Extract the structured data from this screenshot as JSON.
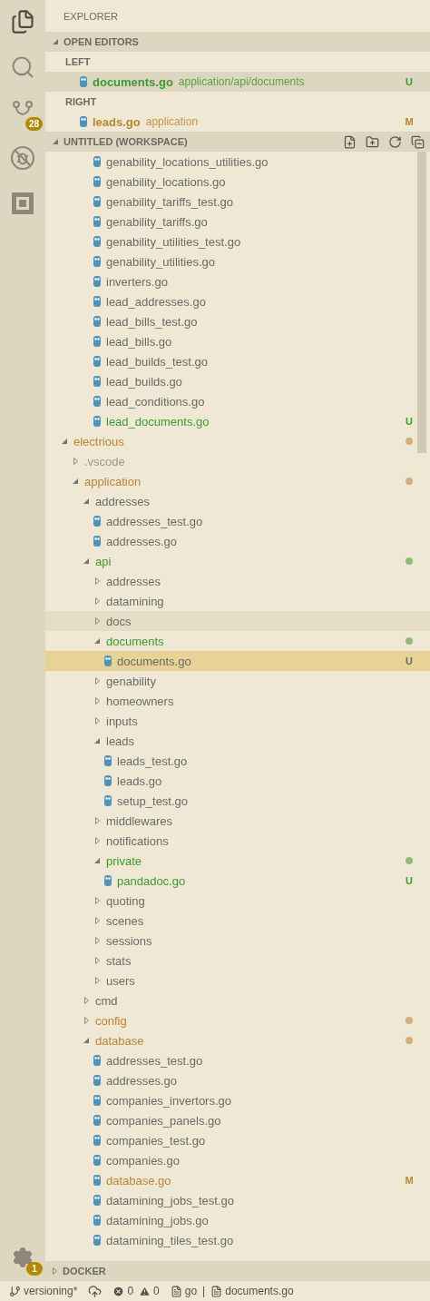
{
  "activity_bar": {
    "source_control_badge": "28",
    "settings_badge": "1"
  },
  "explorer": {
    "title": "EXPLORER",
    "open_editors": {
      "title": "OPEN EDITORS",
      "expanded": true,
      "groups": [
        {
          "label": "LEFT",
          "files": [
            {
              "name": "documents.go",
              "path": "application/api/documents",
              "badge": "U",
              "color": "#3d9a2e",
              "selected": true
            }
          ]
        },
        {
          "label": "RIGHT",
          "files": [
            {
              "name": "leads.go",
              "path": "application",
              "badge": "M",
              "color": "#b8862f",
              "selected": false
            }
          ]
        }
      ]
    },
    "workspace": {
      "title": "UNTITLED (WORKSPACE)",
      "expanded": true,
      "partial_files": [
        {
          "name": "genability_locations_utilities.go",
          "kind": "file",
          "selected": false,
          "hovered": false
        },
        {
          "name": "genability_locations.go",
          "kind": "file",
          "selected": false,
          "hovered": false
        },
        {
          "name": "genability_tariffs_test.go",
          "kind": "file",
          "selected": false,
          "hovered": false
        },
        {
          "name": "genability_tariffs.go",
          "kind": "file",
          "selected": false,
          "hovered": false
        },
        {
          "name": "genability_utilities_test.go",
          "kind": "file",
          "selected": false,
          "hovered": false
        },
        {
          "name": "genability_utilities.go",
          "kind": "file",
          "selected": false,
          "hovered": false
        },
        {
          "name": "inverters.go",
          "kind": "file",
          "selected": false,
          "hovered": false
        },
        {
          "name": "lead_addresses.go",
          "kind": "file",
          "selected": false,
          "hovered": false
        },
        {
          "name": "lead_bills_test.go",
          "kind": "file",
          "selected": false,
          "hovered": false
        },
        {
          "name": "lead_bills.go",
          "kind": "file",
          "selected": false,
          "hovered": false
        },
        {
          "name": "lead_builds_test.go",
          "kind": "file",
          "selected": false,
          "hovered": false
        },
        {
          "name": "lead_builds.go",
          "kind": "file",
          "selected": false,
          "hovered": false
        },
        {
          "name": "lead_conditions.go",
          "kind": "file",
          "selected": false,
          "hovered": false
        },
        {
          "name": "lead_documents.go",
          "kind": "file",
          "color": "#3d9a2e",
          "badge": "U",
          "selected": false,
          "hovered": false
        }
      ],
      "tree": [
        {
          "name": "electrious",
          "kind": "folder",
          "expanded": true,
          "color": "#b8862f",
          "dot": true,
          "selected": false,
          "hovered": false,
          "children": [
            {
              "name": ".vscode",
              "kind": "folder",
              "expanded": false,
              "color": "#9c9a90",
              "dot": false,
              "selected": false,
              "hovered": false
            },
            {
              "name": "application",
              "kind": "folder",
              "expanded": true,
              "color": "#b8862f",
              "dot": true,
              "selected": false,
              "hovered": false,
              "children": [
                {
                  "name": "addresses",
                  "kind": "folder",
                  "expanded": true,
                  "selected": false,
                  "hovered": false,
                  "children": [
                    {
                      "name": "addresses_test.go",
                      "kind": "file",
                      "selected": false,
                      "hovered": false
                    },
                    {
                      "name": "addresses.go",
                      "kind": "file",
                      "selected": false,
                      "hovered": false
                    }
                  ]
                },
                {
                  "name": "api",
                  "kind": "folder",
                  "expanded": true,
                  "color": "#3d9a2e",
                  "dot": true,
                  "selected": false,
                  "hovered": false,
                  "children": [
                    {
                      "name": "addresses",
                      "kind": "folder",
                      "expanded": false,
                      "selected": false,
                      "hovered": false
                    },
                    {
                      "name": "datamining",
                      "kind": "folder",
                      "expanded": false,
                      "selected": false,
                      "hovered": false
                    },
                    {
                      "name": "docs",
                      "kind": "folder",
                      "expanded": false,
                      "selected": false,
                      "hovered": true
                    },
                    {
                      "name": "documents",
                      "kind": "folder",
                      "expanded": true,
                      "color": "#3d9a2e",
                      "dot": true,
                      "selected": false,
                      "hovered": false,
                      "children": [
                        {
                          "name": "documents.go",
                          "kind": "file",
                          "badge": "U",
                          "selected": true,
                          "hovered": false
                        }
                      ]
                    },
                    {
                      "name": "genability",
                      "kind": "folder",
                      "expanded": false,
                      "selected": false,
                      "hovered": false
                    },
                    {
                      "name": "homeowners",
                      "kind": "folder",
                      "expanded": false,
                      "selected": false,
                      "hovered": false
                    },
                    {
                      "name": "inputs",
                      "kind": "folder",
                      "expanded": false,
                      "selected": false,
                      "hovered": false
                    },
                    {
                      "name": "leads",
                      "kind": "folder",
                      "expanded": true,
                      "selected": false,
                      "hovered": false,
                      "children": [
                        {
                          "name": "leads_test.go",
                          "kind": "file",
                          "selected": false,
                          "hovered": false
                        },
                        {
                          "name": "leads.go",
                          "kind": "file",
                          "selected": false,
                          "hovered": false
                        },
                        {
                          "name": "setup_test.go",
                          "kind": "file",
                          "selected": false,
                          "hovered": false
                        }
                      ]
                    },
                    {
                      "name": "middlewares",
                      "kind": "folder",
                      "expanded": false,
                      "selected": false,
                      "hovered": false
                    },
                    {
                      "name": "notifications",
                      "kind": "folder",
                      "expanded": false,
                      "selected": false,
                      "hovered": false
                    },
                    {
                      "name": "private",
                      "kind": "folder",
                      "expanded": true,
                      "color": "#3d9a2e",
                      "dot": true,
                      "selected": false,
                      "hovered": false,
                      "children": [
                        {
                          "name": "pandadoc.go",
                          "kind": "file",
                          "color": "#3d9a2e",
                          "badge": "U",
                          "selected": false,
                          "hovered": false
                        }
                      ]
                    },
                    {
                      "name": "quoting",
                      "kind": "folder",
                      "expanded": false,
                      "selected": false,
                      "hovered": false
                    },
                    {
                      "name": "scenes",
                      "kind": "folder",
                      "expanded": false,
                      "selected": false,
                      "hovered": false
                    },
                    {
                      "name": "sessions",
                      "kind": "folder",
                      "expanded": false,
                      "selected": false,
                      "hovered": false
                    },
                    {
                      "name": "stats",
                      "kind": "folder",
                      "expanded": false,
                      "selected": false,
                      "hovered": false
                    },
                    {
                      "name": "users",
                      "kind": "folder",
                      "expanded": false,
                      "selected": false,
                      "hovered": false
                    }
                  ]
                },
                {
                  "name": "cmd",
                  "kind": "folder",
                  "expanded": false,
                  "selected": false,
                  "hovered": false
                },
                {
                  "name": "config",
                  "kind": "folder",
                  "expanded": false,
                  "color": "#b8862f",
                  "dot": true,
                  "selected": false,
                  "hovered": false
                },
                {
                  "name": "database",
                  "kind": "folder",
                  "expanded": true,
                  "color": "#b8862f",
                  "dot": true,
                  "selected": false,
                  "hovered": false,
                  "children": [
                    {
                      "name": "addresses_test.go",
                      "kind": "file",
                      "selected": false,
                      "hovered": false
                    },
                    {
                      "name": "addresses.go",
                      "kind": "file",
                      "selected": false,
                      "hovered": false
                    },
                    {
                      "name": "companies_invertors.go",
                      "kind": "file",
                      "selected": false,
                      "hovered": false
                    },
                    {
                      "name": "companies_panels.go",
                      "kind": "file",
                      "selected": false,
                      "hovered": false
                    },
                    {
                      "name": "companies_test.go",
                      "kind": "file",
                      "selected": false,
                      "hovered": false
                    },
                    {
                      "name": "companies.go",
                      "kind": "file",
                      "selected": false,
                      "hovered": false
                    },
                    {
                      "name": "database.go",
                      "kind": "file",
                      "color": "#b8862f",
                      "badge": "M",
                      "selected": false,
                      "hovered": false
                    },
                    {
                      "name": "datamining_jobs_test.go",
                      "kind": "file",
                      "selected": false,
                      "hovered": false
                    },
                    {
                      "name": "datamining_jobs.go",
                      "kind": "file",
                      "selected": false,
                      "hovered": false
                    },
                    {
                      "name": "datamining_tiles_test.go",
                      "kind": "file",
                      "selected": false,
                      "hovered": false
                    }
                  ]
                }
              ]
            }
          ]
        }
      ]
    },
    "docker": {
      "title": "DOCKER",
      "expanded": false
    }
  },
  "status_bar": {
    "branch": "versioning*",
    "errors": "0",
    "warnings": "0",
    "language": "go",
    "separator": "|",
    "file": "documents.go"
  }
}
